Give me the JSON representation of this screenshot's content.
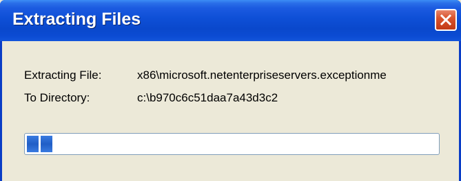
{
  "window": {
    "title": "Extracting Files"
  },
  "fields": {
    "file_label": "Extracting File:",
    "file_value": "x86\\microsoft.netenterpriseservers.exceptionme",
    "dir_label": "To Directory:",
    "dir_value": "c:\\b970c6c51daa7a43d3c2"
  },
  "progress": {
    "fraction": 0.07,
    "blocks_filled": 2
  },
  "colors": {
    "titlebar": "#0A48CC",
    "progress_block": "#215FC7",
    "dialog_bg": "#ECE9D8",
    "close_button": "#D9542E"
  },
  "icons": {
    "close": "close-icon"
  }
}
